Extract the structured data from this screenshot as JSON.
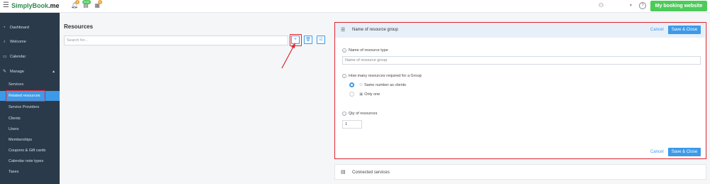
{
  "topbar": {
    "logo_prefix": "SimplyBook",
    "logo_suffix": ".me",
    "badges": [
      "0",
      "2/31",
      "0"
    ],
    "booking_label": "My booking website"
  },
  "sidebar": {
    "items": [
      {
        "label": "Dashboard",
        "icon": "dashboard-icon"
      },
      {
        "label": "Welcome",
        "icon": "bulb-icon"
      },
      {
        "label": "Calendar",
        "icon": "calendar-icon"
      },
      {
        "label": "Manage",
        "icon": "pencil-icon"
      }
    ],
    "subitems": [
      "Services",
      "Related resources",
      "Service Providers",
      "Clients",
      "Users",
      "Memberships",
      "Coupons & Gift cards",
      "Calendar note types",
      "Taxes"
    ],
    "active_index": 1
  },
  "resources": {
    "title": "Resources",
    "search_placeholder": "Search for..."
  },
  "panel": {
    "title": "Name of resource group",
    "cancel_label": "Cancel",
    "save_label": "Save & Close",
    "type_label": "Name of resource type",
    "type_placeholder": "Name of resource group",
    "group_label": "How many resources required for a Group",
    "option_same": "Same number as clients",
    "option_one": "Only one",
    "qty_label": "Qty of resources",
    "qty_value": "1"
  },
  "connected": {
    "label": "Connected services"
  },
  "colors": {
    "accent": "#3d9ae8",
    "brand_green": "#4ccb59",
    "highlight_red": "#e0262f",
    "sidebar_bg": "#2b3a4a"
  }
}
